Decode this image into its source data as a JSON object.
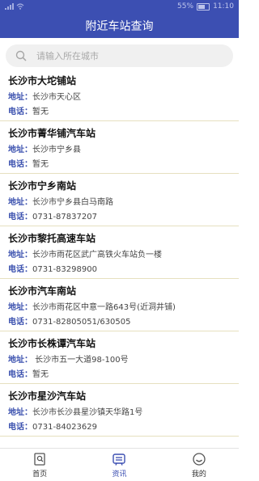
{
  "status": {
    "battery": "55%",
    "time": "11:10"
  },
  "header": {
    "title": "附近车站查询"
  },
  "search": {
    "placeholder": "请输入所在城市"
  },
  "labels": {
    "address": "地址：",
    "phone": "电话："
  },
  "stations": [
    {
      "name": "长沙市大坨铺站",
      "address": "长沙市天心区",
      "phone": "暂无"
    },
    {
      "name": "长沙市菁华铺汽车站",
      "address": "长沙市宁乡县",
      "phone": "暂无"
    },
    {
      "name": "长沙市宁乡南站",
      "address": "长沙市宁乡县白马南路",
      "phone": "0731-87837207"
    },
    {
      "name": "长沙市黎托高速车站",
      "address": "长沙市雨花区武广高铁火车站负一楼",
      "phone": "0731-83298900"
    },
    {
      "name": "长沙市汽车南站",
      "address": "长沙市雨花区中意一路643号(近洞井铺)",
      "phone": "0731-82805051/630505"
    },
    {
      "name": "长沙市长株谭汽车站",
      "address": " 长沙市五一大道98-100号",
      "phone": "暂无"
    },
    {
      "name": "长沙市星沙汽车站",
      "address": "长沙市长沙县星沙镇天华路1号",
      "phone": "0731-84023629"
    }
  ],
  "tabs": [
    {
      "label": "首页",
      "icon": "home-icon"
    },
    {
      "label": "资讯",
      "icon": "news-icon",
      "active": true
    },
    {
      "label": "我的",
      "icon": "profile-icon"
    }
  ],
  "colors": {
    "primary": "#3c4fb2",
    "label": "#3a50ae",
    "divider": "#e6e0bf"
  }
}
